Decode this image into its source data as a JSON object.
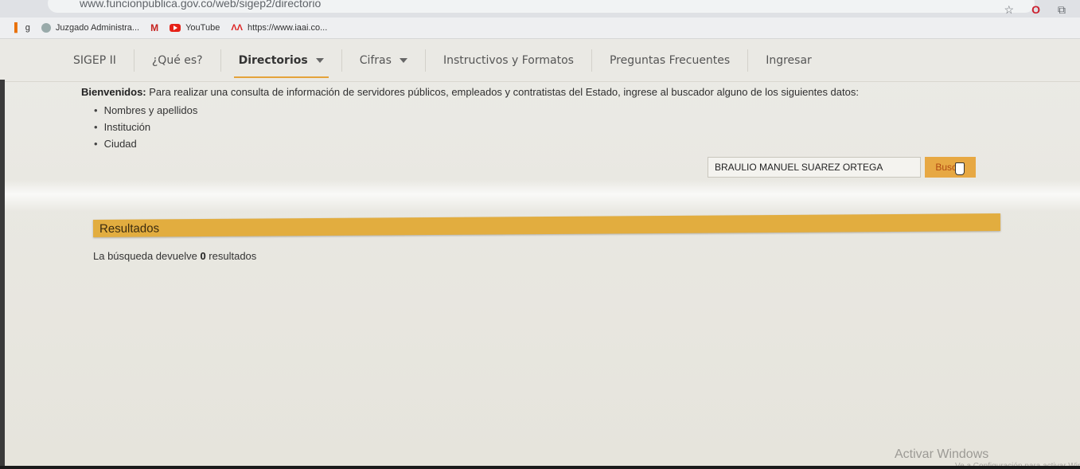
{
  "browser": {
    "url": "www.funcionpublica.gov.co/web/sigep2/directorio",
    "bookmarks": [
      {
        "label": "g"
      },
      {
        "label": "Juzgado Administra..."
      },
      {
        "label": ""
      },
      {
        "label": "YouTube"
      },
      {
        "label": "https://www.iaai.co..."
      }
    ]
  },
  "nav": {
    "items": [
      {
        "label": "SIGEP II"
      },
      {
        "label": "¿Qué es?"
      },
      {
        "label": "Directorios"
      },
      {
        "label": "Cifras"
      },
      {
        "label": "Instructivos y Formatos"
      },
      {
        "label": "Preguntas Frecuentes"
      },
      {
        "label": "Ingresar"
      }
    ]
  },
  "intro": {
    "lead": "Bienvenidos:",
    "text": " Para realizar una consulta de información de servidores públicos, empleados y contratistas del Estado, ingrese al buscador alguno de los siguientes datos:",
    "bullets": [
      "Nombres y apellidos",
      "Institución",
      "Ciudad"
    ]
  },
  "search": {
    "value": "BRAULIO MANUEL SUAREZ ORTEGA",
    "button": "Buscar"
  },
  "results": {
    "title": "Resultados",
    "prefix": "La búsqueda devuelve ",
    "count": "0",
    "suffix": " resultados"
  },
  "watermark": {
    "title": "Activar Windows",
    "subtitle": "Ve a Configuración para activar Windows."
  },
  "colors": {
    "accent": "#e2ad3f",
    "button": "#e7a843"
  }
}
